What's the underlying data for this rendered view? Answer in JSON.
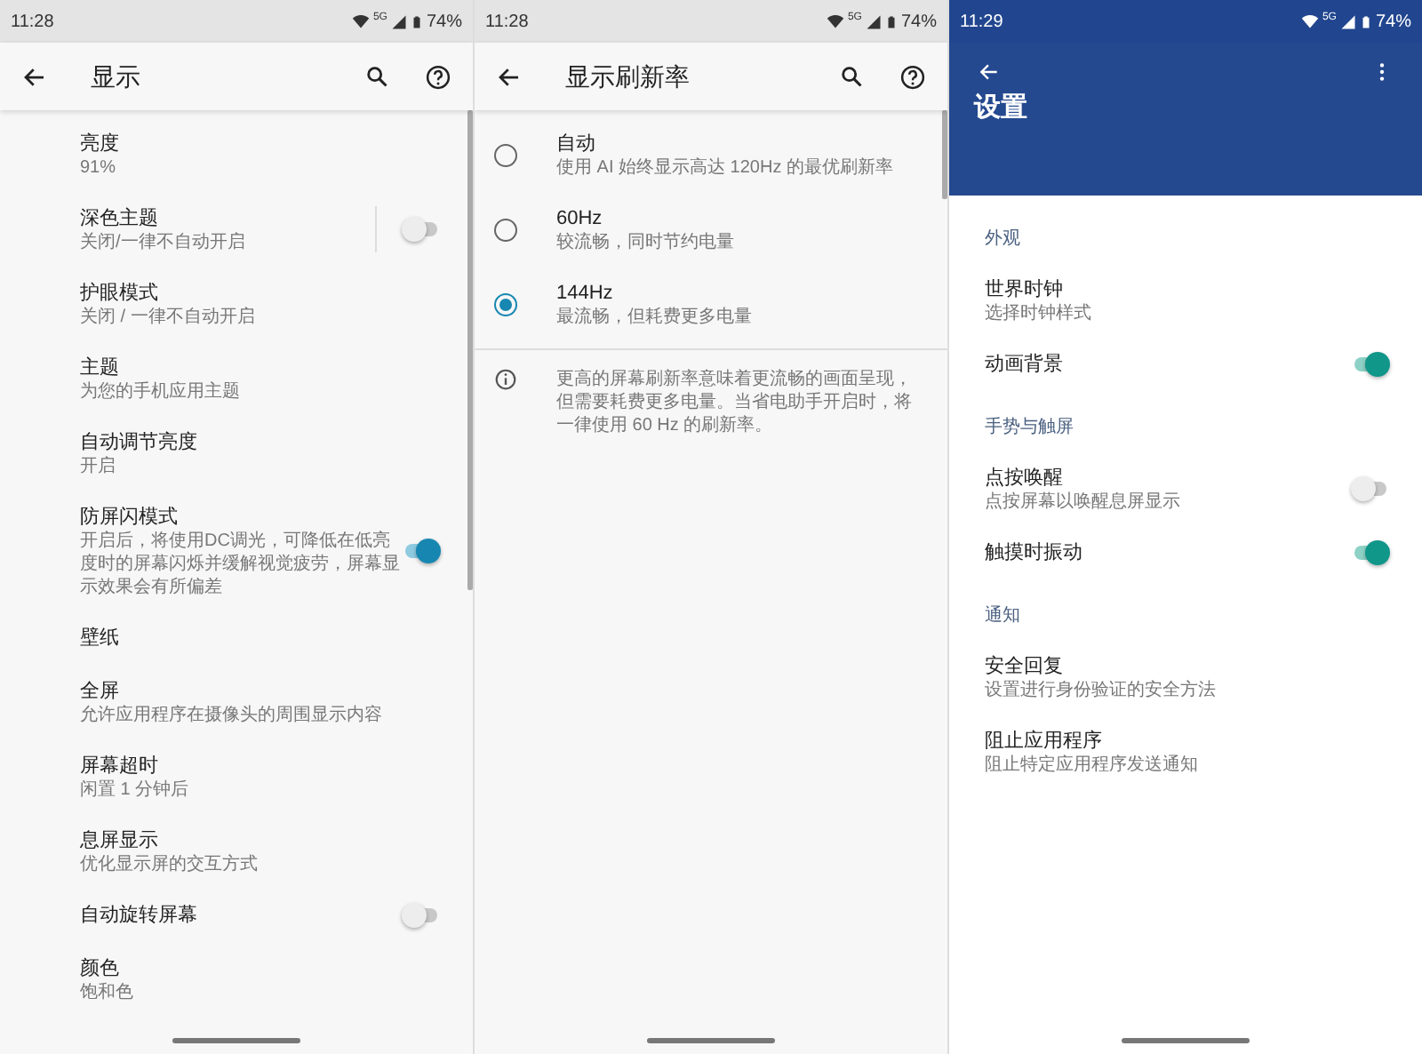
{
  "screens": [
    {
      "kind": "toolbar",
      "status_bar": {
        "time": "11:28",
        "network": "5G",
        "battery": "74%"
      },
      "title": "显示",
      "items": [
        {
          "kind": "item",
          "title": "亮度",
          "subtitle": "91%"
        },
        {
          "kind": "switch",
          "title": "深色主题",
          "subtitle": "关闭/一律不自动开启",
          "on": false,
          "separator": true
        },
        {
          "kind": "item",
          "title": "护眼模式",
          "subtitle": "关闭 / 一律不自动开启"
        },
        {
          "kind": "item",
          "title": "主题",
          "subtitle": "为您的手机应用主题"
        },
        {
          "kind": "item",
          "title": "自动调节亮度",
          "subtitle": "开启"
        },
        {
          "kind": "switch",
          "title": "防屏闪模式",
          "subtitle": "开启后，将使用DC调光，可降低在低亮度时的屏幕闪烁并缓解视觉疲劳，屏幕显示效果会有所偏差",
          "on": true,
          "separator": false
        },
        {
          "kind": "item",
          "title": "壁纸"
        },
        {
          "kind": "item",
          "title": "全屏",
          "subtitle": "允许应用程序在摄像头的周围显示内容"
        },
        {
          "kind": "item",
          "title": "屏幕超时",
          "subtitle": "闲置 1 分钟后"
        },
        {
          "kind": "item",
          "title": "息屏显示",
          "subtitle": "优化显示屏的交互方式"
        },
        {
          "kind": "switch",
          "title": "自动旋转屏幕",
          "on": false,
          "separator": false
        },
        {
          "kind": "item",
          "title": "颜色",
          "subtitle": "饱和色"
        }
      ]
    },
    {
      "kind": "toolbar",
      "status_bar": {
        "time": "11:28",
        "network": "5G",
        "battery": "74%"
      },
      "title": "显示刷新率",
      "items": [
        {
          "kind": "radio",
          "title": "自动",
          "subtitle": "使用 AI 始终显示高达 120Hz 的最优刷新率",
          "selected": false
        },
        {
          "kind": "radio",
          "title": "60Hz",
          "subtitle": "较流畅，同时节约电量",
          "selected": false
        },
        {
          "kind": "radio",
          "title": "144Hz",
          "subtitle": "最流畅，但耗费更多电量",
          "selected": true
        },
        {
          "kind": "note",
          "text": "更高的屏幕刷新率意味着更流畅的画面呈现，但需要耗费更多电量。当省电助手开启时，将一律使用 60 Hz 的刷新率。"
        }
      ]
    },
    {
      "kind": "collapsing",
      "status_bar": {
        "time": "11:29",
        "network": "5G",
        "battery": "74%"
      },
      "title": "设置",
      "items": [
        {
          "kind": "header",
          "title": "外观"
        },
        {
          "kind": "item",
          "title": "世界时钟",
          "subtitle": "选择时钟样式"
        },
        {
          "kind": "switch",
          "title": "动画背景",
          "on": true,
          "separator": false
        },
        {
          "kind": "header",
          "title": "手势与触屏"
        },
        {
          "kind": "switch",
          "title": "点按唤醒",
          "subtitle": "点按屏幕以唤醒息屏显示",
          "on": false,
          "separator": false
        },
        {
          "kind": "switch",
          "title": "触摸时振动",
          "on": true,
          "separator": false
        },
        {
          "kind": "header",
          "title": "通知"
        },
        {
          "kind": "item",
          "title": "安全回复",
          "subtitle": "设置进行身份验证的安全方法"
        },
        {
          "kind": "item",
          "title": "阻止应用程序",
          "subtitle": "阻止特定应用程序发送通知"
        }
      ]
    }
  ]
}
